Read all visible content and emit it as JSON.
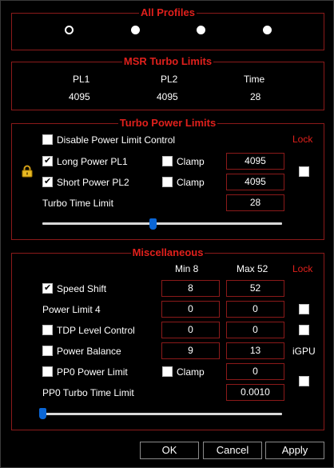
{
  "all_profiles": {
    "title": "All Profiles",
    "radios": [
      {
        "name": "profile-1",
        "selected": true
      },
      {
        "name": "profile-2",
        "selected": false
      },
      {
        "name": "profile-3",
        "selected": false
      },
      {
        "name": "profile-4",
        "selected": false
      }
    ]
  },
  "msr": {
    "title": "MSR Turbo Limits",
    "headers": [
      "PL1",
      "PL2",
      "Time"
    ],
    "values": [
      "4095",
      "4095",
      "28"
    ]
  },
  "turbo": {
    "title": "Turbo Power Limits",
    "disable_label": "Disable Power Limit Control",
    "disable_checked": false,
    "lock_label": "Lock",
    "long_label": "Long Power PL1",
    "long_checked": true,
    "long_clamp_label": "Clamp",
    "long_clamp_checked": false,
    "long_value": "4095",
    "short_label": "Short Power PL2",
    "short_checked": true,
    "short_clamp_label": "Clamp",
    "short_clamp_checked": false,
    "short_value": "4095",
    "lock_checked": false,
    "time_label": "Turbo Time Limit",
    "time_value": "28",
    "slider_fraction": 0.46
  },
  "misc": {
    "title": "Miscellaneous",
    "min_label": "Min  8",
    "max_label": "Max  52",
    "lock_label": "Lock",
    "speed_shift_label": "Speed Shift",
    "speed_shift_checked": true,
    "speed_shift_min": "8",
    "speed_shift_max": "52",
    "pl4_label": "Power Limit 4",
    "pl4_min": "0",
    "pl4_max": "0",
    "pl4_lock_checked": false,
    "tdp_label": "TDP Level Control",
    "tdp_checked": false,
    "tdp_min": "0",
    "tdp_max": "0",
    "tdp_lock_checked": false,
    "balance_label": "Power Balance",
    "balance_checked": false,
    "balance_min": "9",
    "balance_max": "13",
    "igpu_label": "iGPU",
    "pp0_label": "PP0 Power Limit",
    "pp0_checked": false,
    "pp0_clamp_label": "Clamp",
    "pp0_clamp_checked": false,
    "pp0_value": "0",
    "pp0_lock_checked": false,
    "pp0_time_label": "PP0 Turbo Time Limit",
    "pp0_time_value": "0.0010",
    "slider_fraction": 0.0
  },
  "buttons": {
    "ok": "OK",
    "cancel": "Cancel",
    "apply": "Apply"
  },
  "colors": {
    "accent": "#e0201c",
    "border": "#8b1a1a",
    "slider_thumb": "#0a66d6"
  }
}
